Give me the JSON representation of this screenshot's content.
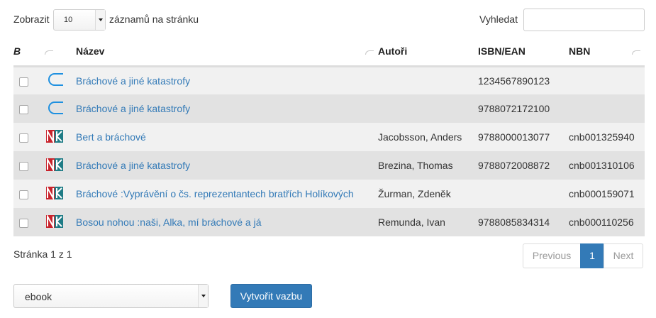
{
  "length_menu": {
    "prefix": "Zobrazit",
    "value": "10",
    "suffix": "záznamů na stránku"
  },
  "search": {
    "label": "Vyhledat",
    "value": ""
  },
  "table": {
    "headers": {
      "check": "B",
      "title": "Název",
      "authors": "Autoři",
      "isbn": "ISBN/EAN",
      "nbn": "NBN"
    },
    "rows": [
      {
        "icon": "ebook-bracket-icon",
        "title": "Bráchové a jiné katastrofy",
        "authors": "",
        "isbn": "1234567890123",
        "nbn": ""
      },
      {
        "icon": "ebook-bracket-icon",
        "title": "Bráchové a jiné katastrofy",
        "authors": "",
        "isbn": "9788072172100",
        "nbn": ""
      },
      {
        "icon": "nk-logo-icon",
        "title": "Bert a bráchové",
        "authors": "Jacobsson, Anders",
        "isbn": "9788000013077",
        "nbn": "cnb001325940"
      },
      {
        "icon": "nk-logo-icon",
        "title": "Bráchové a jiné katastrofy",
        "authors": "Brezina, Thomas",
        "isbn": "9788072008872",
        "nbn": "cnb001310106"
      },
      {
        "icon": "nk-logo-icon",
        "title": "Bráchové :Vyprávění o čs. reprezentantech bratřích Holíkových",
        "authors": "Žurman, Zdeněk",
        "isbn": "",
        "nbn": "cnb000159071"
      },
      {
        "icon": "nk-logo-icon",
        "title": "Bosou nohou :naši, Alka, mí bráchové a já",
        "authors": "Remunda, Ivan",
        "isbn": "9788085834314",
        "nbn": "cnb000110256"
      }
    ]
  },
  "pagination": {
    "info": "Stránka 1 z 1",
    "previous": "Previous",
    "current": "1",
    "next": "Next"
  },
  "link_form": {
    "type_value": "ebook",
    "create_label": "Vytvořit vazbu"
  },
  "colors": {
    "link": "#337ab7",
    "primary": "#337ab7",
    "nk_red": "#c8232c",
    "nk_teal": "#1f7c86"
  }
}
